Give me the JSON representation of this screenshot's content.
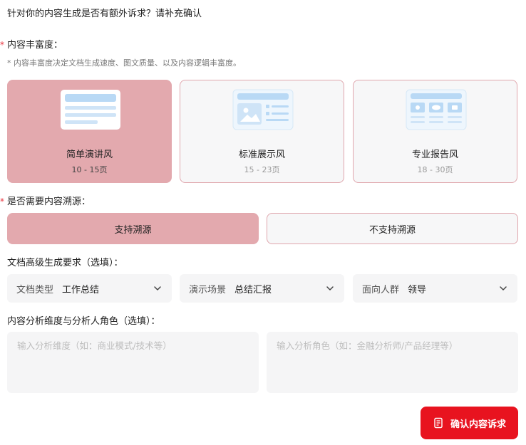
{
  "header": {
    "question": "针对你的内容生成是否有额外诉求？请补充确认"
  },
  "richness": {
    "label": "内容丰富度：",
    "required_mark": "*",
    "hint": "* 内容丰富度决定文档生成速度、图文质量、以及内容逻辑丰富度。",
    "options": [
      {
        "name": "简单演讲风",
        "pages": "10 - 15页",
        "selected": true
      },
      {
        "name": "标准展示风",
        "pages": "15 - 23页",
        "selected": false
      },
      {
        "name": "专业报告风",
        "pages": "18 - 30页",
        "selected": false
      }
    ]
  },
  "tracing": {
    "label": "是否需要内容溯源：",
    "required_mark": "*",
    "options": [
      {
        "label": "支持溯源",
        "selected": true
      },
      {
        "label": "不支持溯源",
        "selected": false
      }
    ]
  },
  "advanced": {
    "label": "文档高级生成要求（选填）：",
    "selects": [
      {
        "label": "文档类型",
        "value": "工作总结",
        "icon": "chevron-down-icon"
      },
      {
        "label": "演示场景",
        "value": "总结汇报",
        "icon": "chevron-down-icon"
      },
      {
        "label": "面向人群",
        "value": "领导",
        "icon": "chevron-down-icon"
      }
    ]
  },
  "analysis": {
    "label": "内容分析维度与分析人角色（选填）：",
    "dimension_placeholder": "输入分析维度（如：商业模式/技术等）",
    "role_placeholder": "输入分析角色（如：金融分析师/产品经理等）",
    "dimension_value": "",
    "role_value": ""
  },
  "actions": {
    "confirm_label": "确认内容诉求",
    "confirm_icon": "document-icon"
  },
  "colors": {
    "accent": "#e8131f",
    "selected_bg": "#e3a9ae",
    "card_border": "#e0a6ad",
    "card_bg": "#f7f7f8",
    "field_bg": "#f5f5f6",
    "thumb_blue": "#b9d9f5"
  }
}
